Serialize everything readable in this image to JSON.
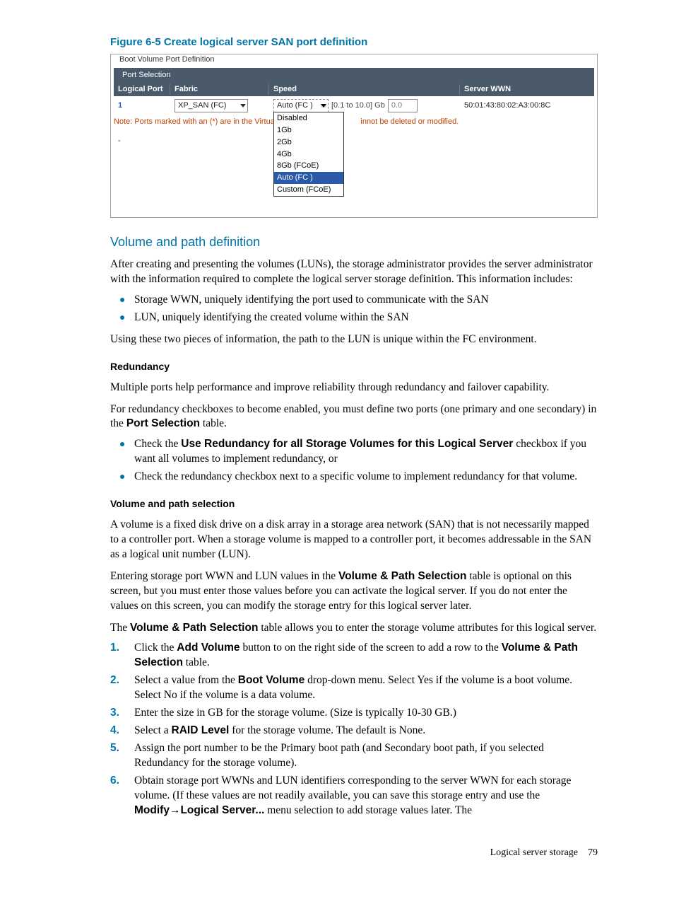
{
  "figure": {
    "caption": "Figure 6-5 Create logical server SAN port definition",
    "legend": "Boot Volume Port Definition",
    "tab": "Port Selection",
    "columns": {
      "logical_port": "Logical Port",
      "fabric": "Fabric",
      "speed": "Speed",
      "server_wwn": "Server WWN"
    },
    "row": {
      "logical_port": "1",
      "fabric_value": "XP_SAN (FC)",
      "speed_value": "Auto (FC )",
      "speed_range": "[0.1 to 10.0] Gb",
      "speed_input": "0.0",
      "server_wwn": "50:01:43:80:02:A3:00:8C"
    },
    "note_left": "Note: Ports marked with an (*) are in the Virtual C",
    "note_right": "innot be deleted or modified.",
    "placeholder_dash": "-",
    "speed_options": [
      "Disabled",
      "1Gb",
      "2Gb",
      "4Gb",
      "8Gb (FCoE)",
      "Auto (FC )",
      "Custom (FCoE)"
    ]
  },
  "section_vol_path": {
    "title": "Volume and path definition",
    "p1": "After creating and presenting the volumes (LUNs), the storage administrator provides the server administrator with the information required to complete the logical server storage definition. This information includes:",
    "bullets": [
      "Storage WWN, uniquely identifying the port used to communicate with the SAN",
      "LUN, uniquely identifying the created volume within the SAN"
    ],
    "p2": "Using these two pieces of information, the path to the LUN is unique within the FC environment."
  },
  "section_redundancy": {
    "title": "Redundancy",
    "p1": "Multiple ports help performance and improve reliability through redundancy and failover capability.",
    "p2_a": "For redundancy checkboxes to become enabled, you must define two ports (one primary and one secondary) in the ",
    "p2_bold": "Port Selection",
    "p2_b": " table.",
    "bullets": [
      {
        "a": "Check the ",
        "bold": "Use Redundancy for all Storage Volumes for this Logical Server",
        "b": " checkbox if you want all volumes to implement redundancy, or"
      },
      {
        "a": "Check the redundancy checkbox next to a specific volume to implement redundancy for that volume.",
        "bold": "",
        "b": ""
      }
    ]
  },
  "section_volpath_sel": {
    "title": "Volume and path selection",
    "p1": "A volume is a fixed disk drive on a disk array in a storage area network (SAN) that is not necessarily mapped to a controller port. When a storage volume is mapped to a controller port, it becomes addressable in the SAN as a logical unit number (LUN).",
    "p2_a": "Entering storage port WWN and LUN values in the ",
    "p2_bold": "Volume & Path Selection",
    "p2_b": " table is optional on this screen, but you must enter those values before you can activate the logical server. If you do not enter the values on this screen, you can modify the storage entry for this logical server later.",
    "p3_a": "The ",
    "p3_bold": "Volume & Path Selection",
    "p3_b": " table allows you to enter the storage volume attributes for this logical server.",
    "steps": [
      {
        "a": "Click the ",
        "b1": "Add Volume",
        "c": " button to on the right side of the screen to add a row to the ",
        "b2": "Volume & Path Selection",
        "d": " table."
      },
      {
        "a": "Select a value from the ",
        "b1": "Boot Volume",
        "c": " drop-down menu. Select Yes if the volume is a boot volume. Select No if the volume is a data volume.",
        "b2": "",
        "d": ""
      },
      {
        "a": "Enter the size in GB for the storage volume. (Size is typically 10-30 GB.)",
        "b1": "",
        "c": "",
        "b2": "",
        "d": ""
      },
      {
        "a": "Select a ",
        "b1": "RAID Level",
        "c": " for the storage volume. The default is None.",
        "b2": "",
        "d": ""
      },
      {
        "a": "Assign the port number to be the Primary boot path (and Secondary boot path, if you selected Redundancy for the storage volume).",
        "b1": "",
        "c": "",
        "b2": "",
        "d": ""
      },
      {
        "a": "Obtain storage port WWNs and LUN identifiers corresponding to the server WWN for each storage volume. (If these values are not readily available, you can save this storage entry and use the ",
        "b1": "Modify",
        "arrow": "→",
        "b2": "Logical Server...",
        "c": " menu selection to add storage values later. The",
        "d": ""
      }
    ]
  },
  "footer": {
    "section": "Logical server storage",
    "page": "79"
  }
}
